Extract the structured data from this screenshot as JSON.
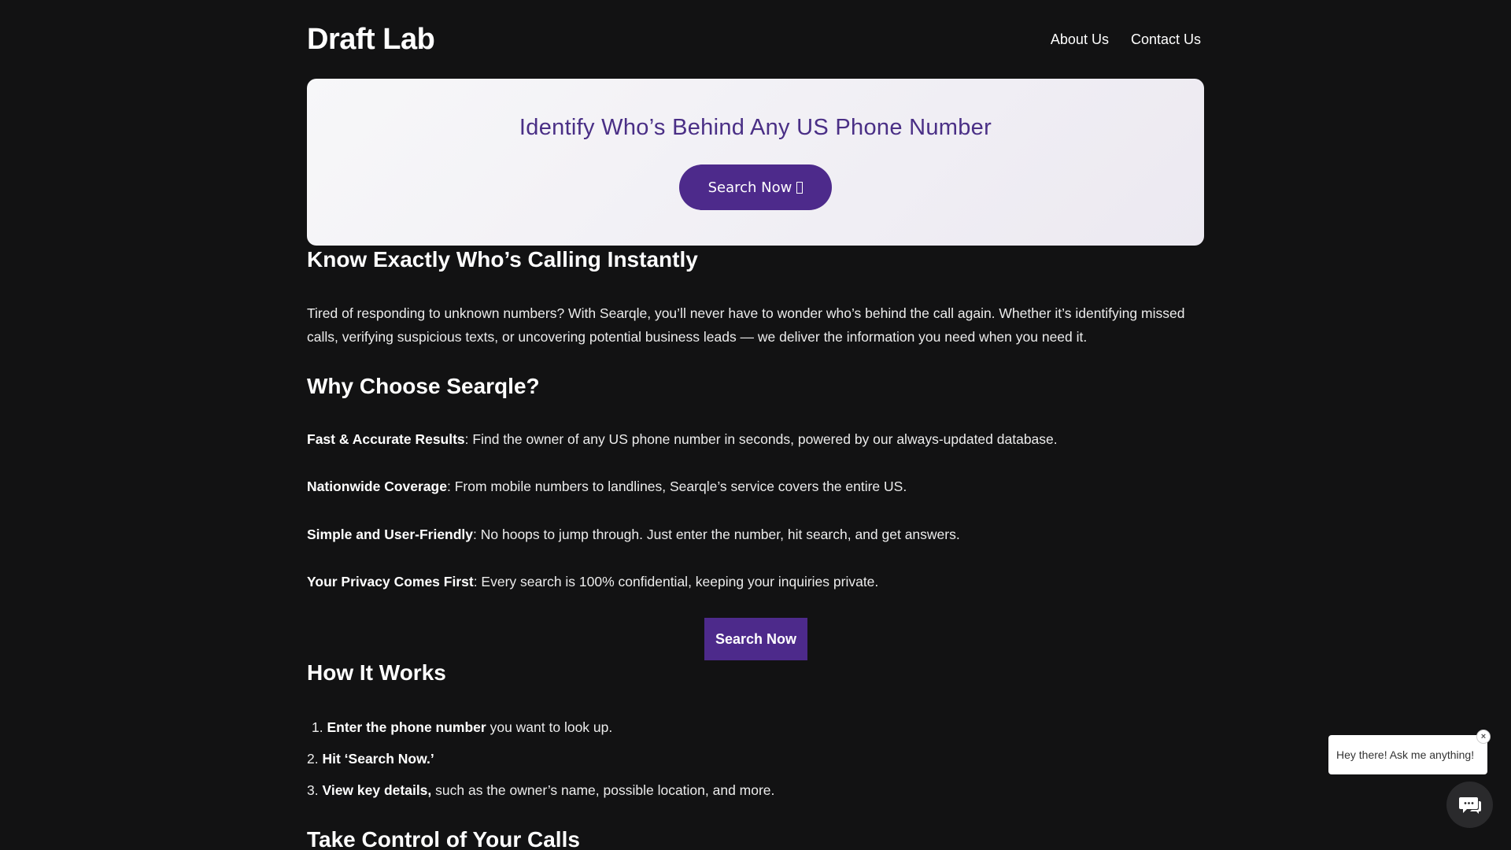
{
  "header": {
    "logo": "Draft Lab",
    "nav": [
      "About Us",
      "Contact Us"
    ]
  },
  "hero": {
    "title": "Identify Who’s Behind Any US Phone Number",
    "button_label": "Search Now",
    "button_icon": "missing-glyph-icon"
  },
  "section_instant": {
    "heading": "Know Exactly Who’s Calling Instantly",
    "paragraph": "Tired of responding to unknown numbers? With Searqle, you’ll never have to wonder who’s behind the call again. Whether it’s identifying missed calls, verifying suspicious texts, or uncovering potential business leads — we deliver the information you need when you need it."
  },
  "section_why": {
    "heading": "Why Choose Searqle?",
    "features": [
      {
        "title": "Fast & Accurate Results",
        "text": ": Find the owner of any US phone number in seconds, powered by our always-updated database."
      },
      {
        "title": "Nationwide Coverage",
        "text": ": From mobile numbers to landlines, Searqle’s service covers the entire US."
      },
      {
        "title": "Simple and User-Friendly",
        "text": ": No hoops to jump through. Just enter the number, hit search, and get answers."
      },
      {
        "title": "Your Privacy Comes First",
        "text": ": Every search is 100% confidential, keeping your inquiries private."
      }
    ],
    "cta_label": "Search Now"
  },
  "section_how": {
    "heading": "How It Works",
    "steps": [
      {
        "num": "1.",
        "bold": "Enter the phone number",
        "text": " you want to look up."
      },
      {
        "num": "2.",
        "bold": "Hit ‘Search Now.’",
        "text": ""
      },
      {
        "num": "3.",
        "bold": "View key details,",
        "text": " such as the owner’s name, possible location, and more."
      }
    ]
  },
  "section_control": {
    "heading": "Take Control of Your Calls"
  },
  "chat": {
    "bubble_text": "Hey there! Ask me anything!",
    "close_glyph": "×",
    "launcher_icon": "chat-icon"
  },
  "colors": {
    "background": "#121213",
    "accent": "#4d2a8b",
    "hero_title": "#4a2f86"
  }
}
